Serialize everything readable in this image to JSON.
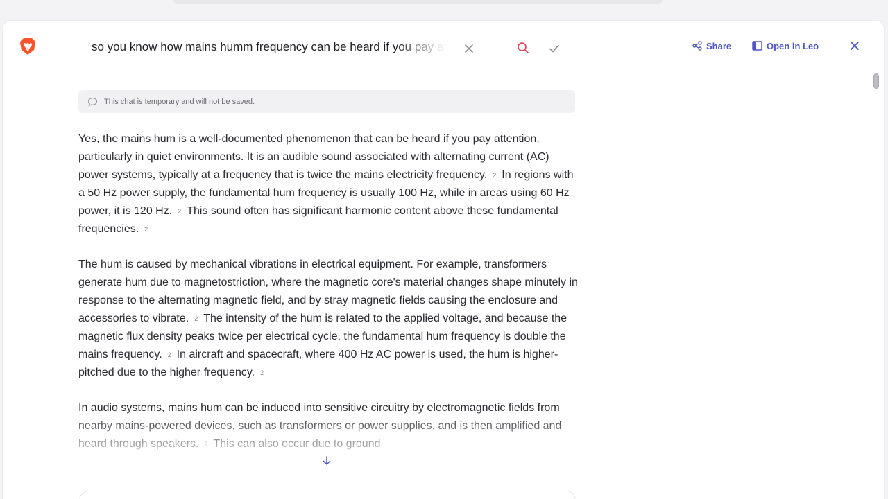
{
  "search": {
    "query": "so you know how mains humm frequency can be heard if you pay attention"
  },
  "header": {
    "share_label": "Share",
    "open_in_leo_label": "Open in Leo"
  },
  "notice": {
    "text": "This chat is temporary and will not be saved."
  },
  "citation_label": "2",
  "answer": {
    "p1": {
      "s1": "Yes, the mains hum is a well-documented phenomenon that can be heard if you pay attention, particularly in quiet environments. It is an audible sound associated with alternating current (AC) power systems, typically at a frequency that is twice the mains electricity frequency.",
      "s2": "In regions with a 50 Hz power supply, the fundamental hum frequency is usually 100 Hz, while in areas using 60 Hz power, it is 120 Hz.",
      "s3": "This sound often has significant harmonic content above these fundamental frequencies."
    },
    "p2": {
      "s1": "The hum is caused by mechanical vibrations in electrical equipment. For example, transformers generate hum due to magnetostriction, where the magnetic core's material changes shape minutely in response to the alternating magnetic field, and by stray magnetic fields causing the enclosure and accessories to vibrate.",
      "s2": "The intensity of the hum is related to the applied voltage, and because the magnetic flux density peaks twice per electrical cycle, the fundamental hum frequency is double the mains frequency.",
      "s3": "In aircraft and spacecraft, where 400 Hz AC power is used, the hum is higher-pitched due to the higher frequency."
    },
    "p3": {
      "s1": "In audio systems, mains hum can be induced into sensitive circuitry by electromagnetic fields from nearby mains-powered devices, such as transformers or power supplies, and is then amplified and heard through speakers.",
      "s2": "This can also occur due to ground"
    }
  },
  "icons": {
    "logo": "brave-lion-logo",
    "clear": "close-icon",
    "search": "search-icon",
    "confirm": "checkmark-icon",
    "share": "share-icon",
    "open_in_leo": "sidebar-panel-icon",
    "close": "close-icon",
    "notice": "chat-bubble-icon",
    "scroll_down": "arrow-down-icon"
  },
  "colors": {
    "accent": "#4d56c8",
    "brand": "#fb542b",
    "search_icon": "#e8435a",
    "text": "#2a2a30",
    "muted": "#6a6a72"
  }
}
